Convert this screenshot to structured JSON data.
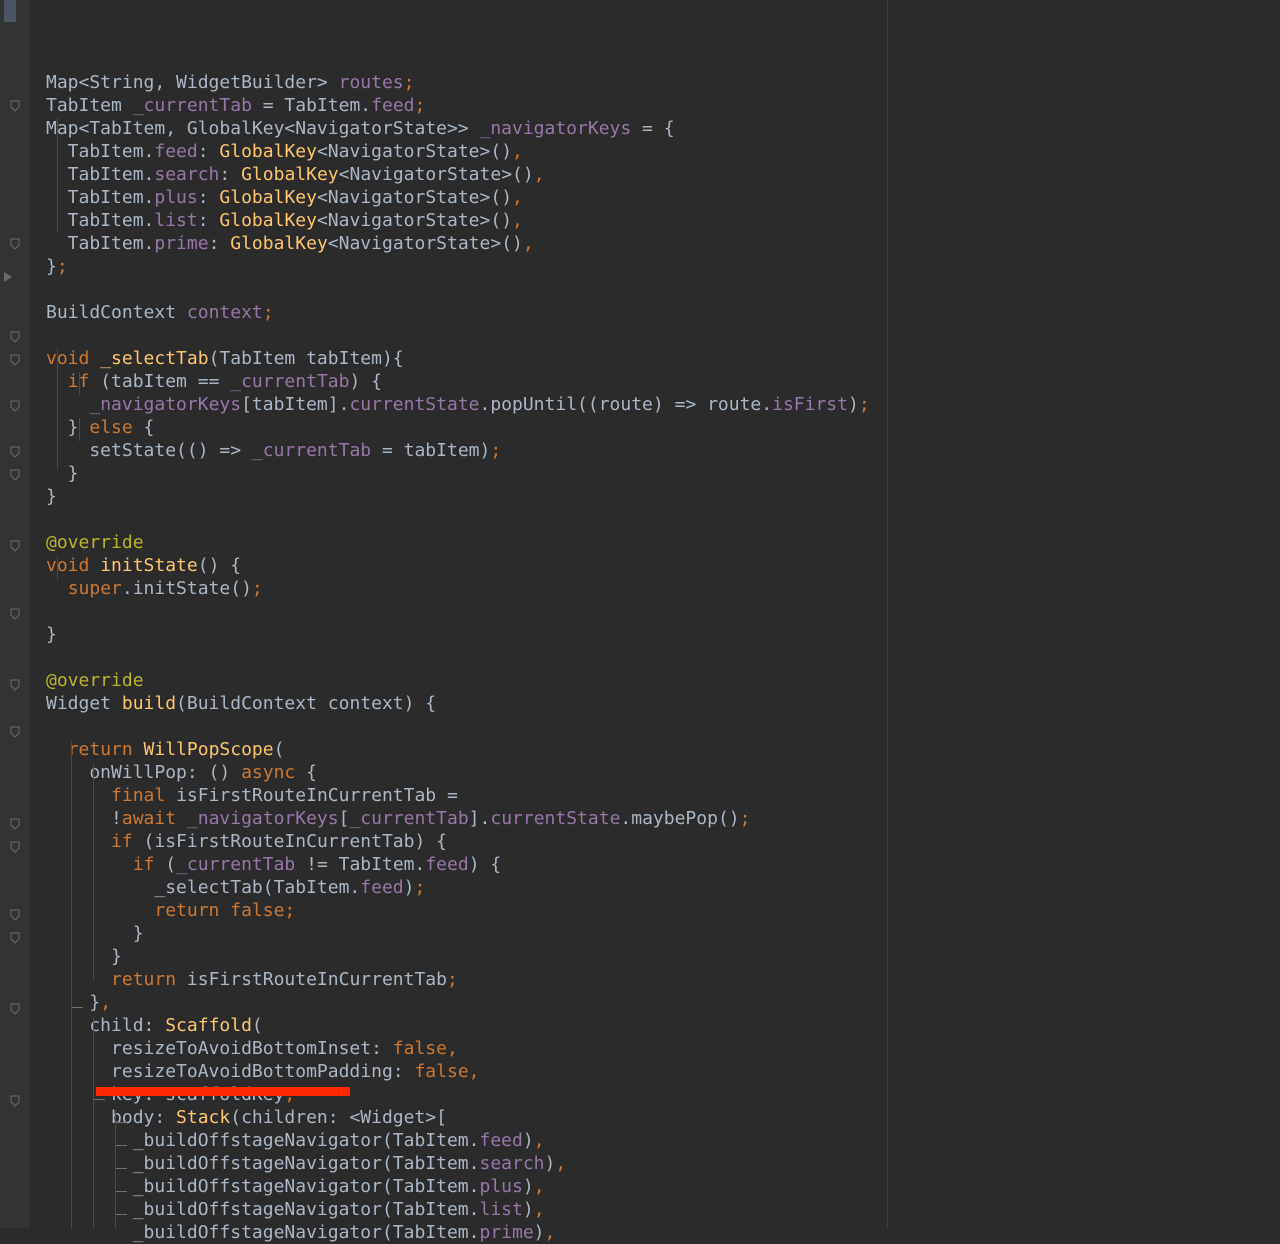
{
  "editor": {
    "language": "Dart",
    "colors": {
      "background": "#2b2b2b",
      "text": "#a9b7c6",
      "keyword": "#cc7832",
      "function": "#ffc66d",
      "field": "#9876aa",
      "annotation": "#bbb529",
      "highlight_underline": "#ff2600"
    },
    "lines": [
      [
        [
          "",
          "t"
        ]
      ],
      [
        [
          "Map<String, WidgetBuilder> ",
          "t"
        ],
        [
          "routes",
          "fld"
        ],
        [
          ";",
          "kw"
        ]
      ],
      [
        [
          "TabItem ",
          "t"
        ],
        [
          "_currentTab",
          "fld"
        ],
        [
          " = TabItem.",
          "t"
        ],
        [
          "feed",
          "fld"
        ],
        [
          ";",
          "kw"
        ]
      ],
      [
        [
          "Map<TabItem, GlobalKey<NavigatorState>> ",
          "t"
        ],
        [
          "_navigatorKeys",
          "fld"
        ],
        [
          " = {",
          "t"
        ]
      ],
      [
        [
          "  TabItem.",
          "t"
        ],
        [
          "feed",
          "fld"
        ],
        [
          ": ",
          "t"
        ],
        [
          "GlobalKey",
          "fn"
        ],
        [
          "<NavigatorState>()",
          "t"
        ],
        [
          ",",
          "kw"
        ]
      ],
      [
        [
          "  TabItem.",
          "t"
        ],
        [
          "search",
          "fld"
        ],
        [
          ": ",
          "t"
        ],
        [
          "GlobalKey",
          "fn"
        ],
        [
          "<NavigatorState>()",
          "t"
        ],
        [
          ",",
          "kw"
        ]
      ],
      [
        [
          "  TabItem.",
          "t"
        ],
        [
          "plus",
          "fld"
        ],
        [
          ": ",
          "t"
        ],
        [
          "GlobalKey",
          "fn"
        ],
        [
          "<NavigatorState>()",
          "t"
        ],
        [
          ",",
          "kw"
        ]
      ],
      [
        [
          "  TabItem.",
          "t"
        ],
        [
          "list",
          "fld"
        ],
        [
          ": ",
          "t"
        ],
        [
          "GlobalKey",
          "fn"
        ],
        [
          "<NavigatorState>()",
          "t"
        ],
        [
          ",",
          "kw"
        ]
      ],
      [
        [
          "  TabItem.",
          "t"
        ],
        [
          "prime",
          "fld"
        ],
        [
          ": ",
          "t"
        ],
        [
          "GlobalKey",
          "fn"
        ],
        [
          "<NavigatorState>()",
          "t"
        ],
        [
          ",",
          "kw"
        ]
      ],
      [
        [
          "}",
          "t"
        ],
        [
          ";",
          "kw"
        ]
      ],
      [
        [
          "",
          "t"
        ]
      ],
      [
        [
          "BuildContext ",
          "t"
        ],
        [
          "context",
          "fld"
        ],
        [
          ";",
          "kw"
        ]
      ],
      [
        [
          "",
          "t"
        ]
      ],
      [
        [
          "void ",
          "kw"
        ],
        [
          "_selectTab",
          "fn"
        ],
        [
          "(TabItem tabItem){",
          "t"
        ]
      ],
      [
        [
          "  ",
          "t"
        ],
        [
          "if ",
          "kw"
        ],
        [
          "(tabItem == ",
          "t"
        ],
        [
          "_currentTab",
          "fld"
        ],
        [
          ") {",
          "t"
        ]
      ],
      [
        [
          "    ",
          "t"
        ],
        [
          "_navigatorKeys",
          "fld"
        ],
        [
          "[tabItem].",
          "t"
        ],
        [
          "currentState",
          "fld"
        ],
        [
          ".popUntil((route) => route.",
          "t"
        ],
        [
          "isFirst",
          "fld"
        ],
        [
          ")",
          "t"
        ],
        [
          ";",
          "kw"
        ]
      ],
      [
        [
          "  } ",
          "t"
        ],
        [
          "else ",
          "kw"
        ],
        [
          "{",
          "t"
        ]
      ],
      [
        [
          "    setState(() => ",
          "t"
        ],
        [
          "_currentTab",
          "fld"
        ],
        [
          " = tabItem)",
          "t"
        ],
        [
          ";",
          "kw"
        ]
      ],
      [
        [
          "  }",
          "t"
        ]
      ],
      [
        [
          "}",
          "t"
        ]
      ],
      [
        [
          "",
          "t"
        ]
      ],
      [
        [
          "@override",
          "ann"
        ]
      ],
      [
        [
          "void ",
          "kw"
        ],
        [
          "initState",
          "fn"
        ],
        [
          "() {",
          "t"
        ]
      ],
      [
        [
          "  ",
          "t"
        ],
        [
          "super",
          "kw"
        ],
        [
          ".initState()",
          "t"
        ],
        [
          ";",
          "kw"
        ]
      ],
      [
        [
          "",
          "t"
        ]
      ],
      [
        [
          "}",
          "t"
        ]
      ],
      [
        [
          "",
          "t"
        ]
      ],
      [
        [
          "@override",
          "ann"
        ]
      ],
      [
        [
          "Widget ",
          "t"
        ],
        [
          "build",
          "fn"
        ],
        [
          "(BuildContext context) {",
          "t"
        ]
      ],
      [
        [
          "",
          "t"
        ]
      ],
      [
        [
          "  ",
          "t"
        ],
        [
          "return ",
          "kw"
        ],
        [
          "WillPopScope",
          "fn"
        ],
        [
          "(",
          "t"
        ]
      ],
      [
        [
          "    onWillPop: () ",
          "t"
        ],
        [
          "async ",
          "kw"
        ],
        [
          "{",
          "t"
        ]
      ],
      [
        [
          "      ",
          "t"
        ],
        [
          "final ",
          "kw"
        ],
        [
          "isFirstRouteInCurrentTab =",
          "t"
        ]
      ],
      [
        [
          "      !",
          "t"
        ],
        [
          "await ",
          "kw"
        ],
        [
          "_navigatorKeys",
          "fld"
        ],
        [
          "[",
          "t"
        ],
        [
          "_currentTab",
          "fld"
        ],
        [
          "].",
          "t"
        ],
        [
          "currentState",
          "fld"
        ],
        [
          ".maybePop()",
          "t"
        ],
        [
          ";",
          "kw"
        ]
      ],
      [
        [
          "      ",
          "t"
        ],
        [
          "if ",
          "kw"
        ],
        [
          "(isFirstRouteInCurrentTab) {",
          "t"
        ]
      ],
      [
        [
          "        ",
          "t"
        ],
        [
          "if ",
          "kw"
        ],
        [
          "(",
          "t"
        ],
        [
          "_currentTab",
          "fld"
        ],
        [
          " != TabItem.",
          "t"
        ],
        [
          "feed",
          "fld"
        ],
        [
          ") {",
          "t"
        ]
      ],
      [
        [
          "          _selectTab(TabItem.",
          "t"
        ],
        [
          "feed",
          "fld"
        ],
        [
          ")",
          "t"
        ],
        [
          ";",
          "kw"
        ]
      ],
      [
        [
          "          ",
          "t"
        ],
        [
          "return false",
          "kw"
        ],
        [
          ";",
          "kw"
        ]
      ],
      [
        [
          "        }",
          "t"
        ]
      ],
      [
        [
          "      }",
          "t"
        ]
      ],
      [
        [
          "      ",
          "t"
        ],
        [
          "return ",
          "kw"
        ],
        [
          "isFirstRouteInCurrentTab",
          "t"
        ],
        [
          ";",
          "kw"
        ]
      ],
      [
        [
          "    }",
          "t"
        ],
        [
          ",",
          "kw"
        ]
      ],
      [
        [
          "    child: ",
          "t"
        ],
        [
          "Scaffold",
          "fn"
        ],
        [
          "(",
          "t"
        ]
      ],
      [
        [
          "      resizeToAvoidBottomInset: ",
          "t"
        ],
        [
          "false",
          "kw"
        ],
        [
          ",",
          "kw"
        ]
      ],
      [
        [
          "      resizeToAvoidBottomPadding: ",
          "t"
        ],
        [
          "false",
          "kw"
        ],
        [
          ",",
          "kw"
        ]
      ],
      [
        [
          "      key: scaffoldKey",
          "t"
        ],
        [
          ",",
          "kw"
        ]
      ],
      [
        [
          "      body: ",
          "t"
        ],
        [
          "Stack",
          "fn"
        ],
        [
          "(children: <Widget>[",
          "t"
        ]
      ],
      [
        [
          "        _buildOffstageNavigator(TabItem.",
          "t"
        ],
        [
          "feed",
          "fld"
        ],
        [
          ")",
          "t"
        ],
        [
          ",",
          "kw"
        ]
      ],
      [
        [
          "        _buildOffstageNavigator(TabItem.",
          "t"
        ],
        [
          "search",
          "fld"
        ],
        [
          ")",
          "t"
        ],
        [
          ",",
          "kw"
        ]
      ],
      [
        [
          "        _buildOffstageNavigator(TabItem.",
          "t"
        ],
        [
          "plus",
          "fld"
        ],
        [
          ")",
          "t"
        ],
        [
          ",",
          "kw"
        ]
      ],
      [
        [
          "        _buildOffstageNavigator(TabItem.",
          "t"
        ],
        [
          "list",
          "fld"
        ],
        [
          ")",
          "t"
        ],
        [
          ",",
          "kw"
        ]
      ],
      [
        [
          "        _buildOffstageNavigator(TabItem.",
          "t"
        ],
        [
          "prime",
          "fld"
        ],
        [
          ")",
          "t"
        ],
        [
          ",",
          "kw"
        ]
      ]
    ]
  }
}
